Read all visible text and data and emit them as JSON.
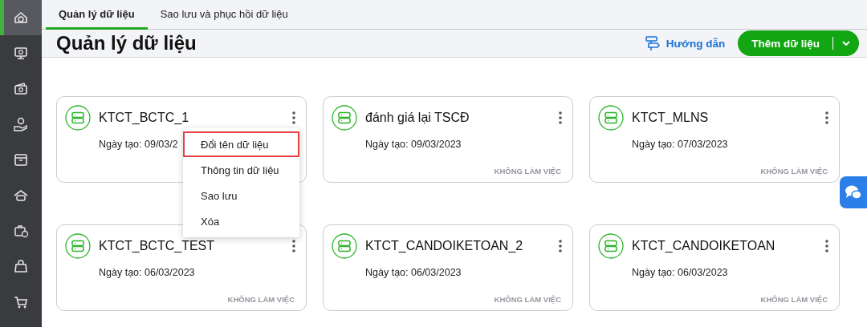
{
  "sidebar": {
    "items": [
      {
        "selected": true
      },
      {
        "selected": false
      },
      {
        "selected": false
      },
      {
        "selected": false
      },
      {
        "selected": false
      },
      {
        "selected": false
      },
      {
        "selected": false
      },
      {
        "selected": false
      },
      {
        "selected": false
      }
    ]
  },
  "tabs": [
    {
      "label": "Quản lý dữ liệu",
      "selected": true
    },
    {
      "label": "Sao lưu và phục hồi dữ liệu",
      "selected": false
    }
  ],
  "header": {
    "title": "Quản lý dữ liệu",
    "guide_link": "Hướng dẫn",
    "add_button": "Thêm dữ liệu"
  },
  "cards": [
    {
      "name": "KTCT_BCTC_1",
      "date": "Ngày tạo: 09/03/2"
    },
    {
      "name": "đánh giá lại TSCĐ",
      "date": "Ngày tạo: 09/03/2023",
      "status": "KHÔNG LÀM VIỆC"
    },
    {
      "name": "KTCT_MLNS",
      "date": "Ngày tạo: 07/03/2023",
      "status": "KHÔNG LÀM VIỆC"
    },
    {
      "name": "KTCT_BCTC_TEST",
      "date": "Ngày tạo: 06/03/2023",
      "status": "KHÔNG LÀM VIỆC"
    },
    {
      "name": "KTCT_CANDOIKETOAN_2",
      "date": "Ngày tạo: 06/03/2023",
      "status": "KHÔNG LÀM VIỆC"
    },
    {
      "name": "KTCT_CANDOIKETOAN",
      "date": "Ngày tạo: 06/03/2023",
      "status": "KHÔNG LÀM VIỆC"
    }
  ],
  "context_menu": {
    "items": [
      {
        "label": "Đổi tên dữ liệu",
        "highlighted": true
      },
      {
        "label": "Thông tin dữ liệu",
        "highlighted": false
      },
      {
        "label": "Sao lưu",
        "highlighted": false
      },
      {
        "label": "Xóa",
        "highlighted": false
      }
    ]
  }
}
